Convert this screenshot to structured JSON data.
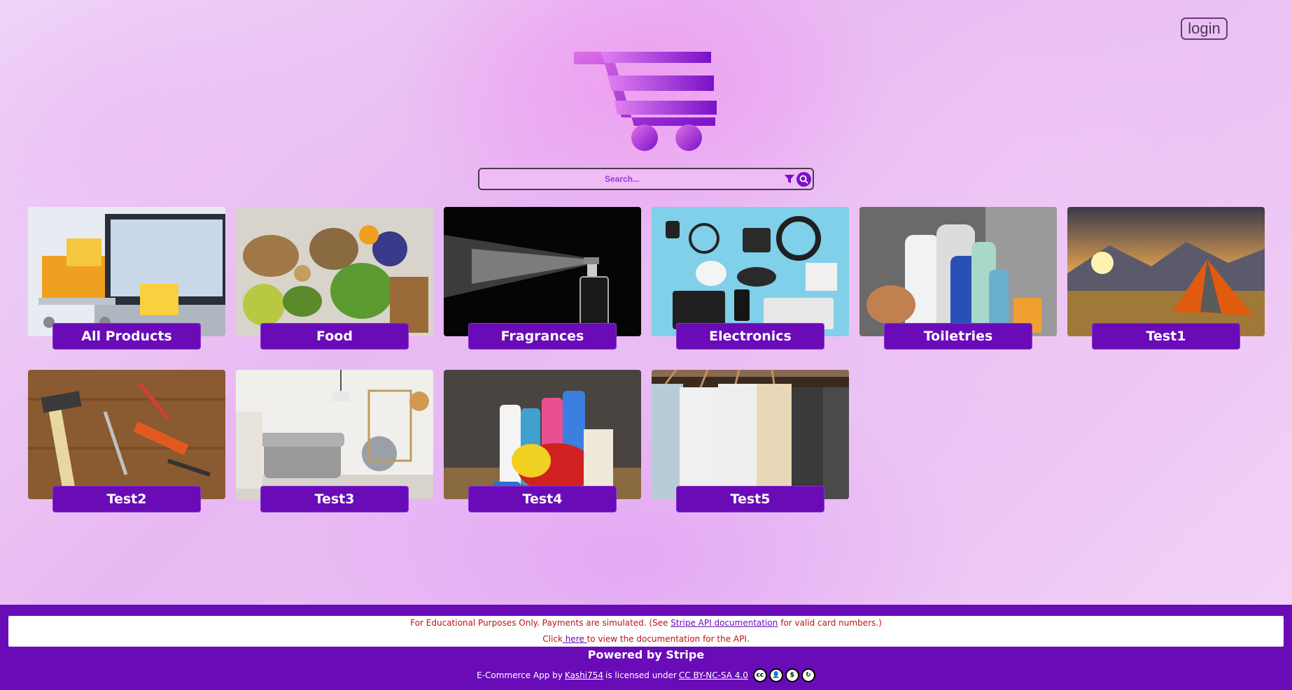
{
  "header": {
    "login_label": "login"
  },
  "search": {
    "placeholder": "Search..."
  },
  "categories": [
    {
      "label": "All Products",
      "image": "shopping-cart-laptop-image"
    },
    {
      "label": "Food",
      "image": "healthy-food-image"
    },
    {
      "label": "Fragrances",
      "image": "perfume-spray-image"
    },
    {
      "label": "Electronics",
      "image": "electronics-flatlay-image"
    },
    {
      "label": "Toiletries",
      "image": "toiletry-bottles-image"
    },
    {
      "label": "Test1",
      "image": "tent-mountain-sunset-image"
    },
    {
      "label": "Test2",
      "image": "tools-on-wood-image"
    },
    {
      "label": "Test3",
      "image": "living-room-image"
    },
    {
      "label": "Test4",
      "image": "cleaning-supplies-image"
    },
    {
      "label": "Test5",
      "image": "clothes-on-hangers-image"
    }
  ],
  "footer": {
    "notice_line1_pre": "For Educational Purposes Only. Payments are simulated. (See ",
    "notice_line1_link": "Stripe API documentation",
    "notice_line1_post": " for valid card numbers.)",
    "notice_line2_pre": "Click",
    "notice_line2_link": " here ",
    "notice_line2_post": "to view the documentation for the API.",
    "powered_by": "Powered by Stripe",
    "license_pre": "E-Commerce App by",
    "license_author": " Kashi754",
    "license_mid": " is licensed under ",
    "license_name": "CC BY-NC-SA 4.0 ",
    "license_icons": [
      "cc-icon",
      "by-icon",
      "nc-icon",
      "sa-icon"
    ]
  },
  "colors": {
    "accent": "#6a0bb8",
    "notice_text": "#c01010"
  }
}
